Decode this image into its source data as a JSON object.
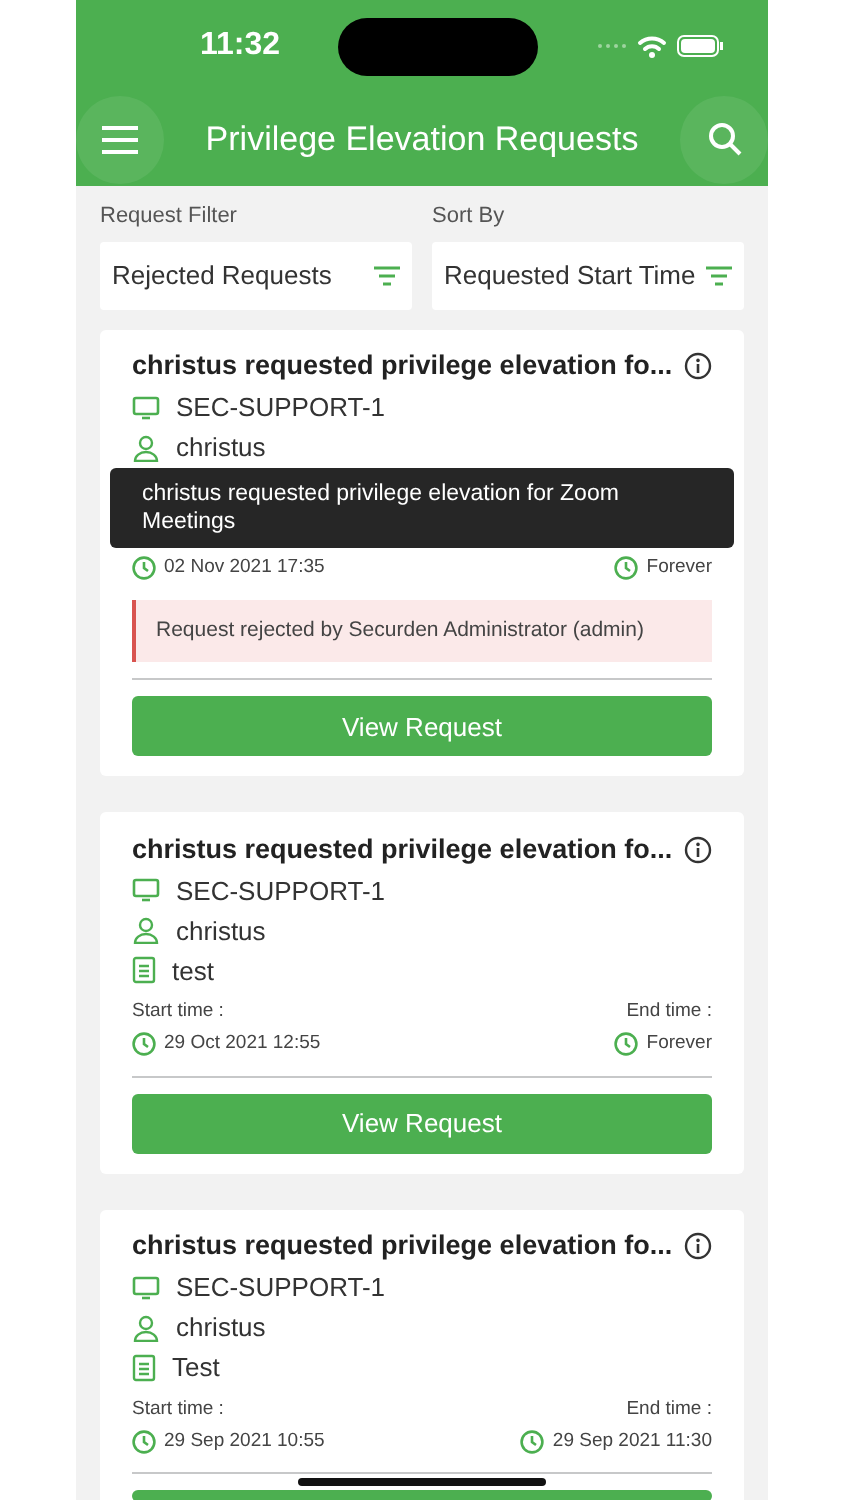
{
  "status_bar": {
    "time": "11:32"
  },
  "header": {
    "title": "Privilege Elevation Requests"
  },
  "filters": [
    {
      "label": "Request Filter",
      "value": "Rejected Requests"
    },
    {
      "label": "Sort By",
      "value": "Requested Start Time"
    }
  ],
  "requests": [
    {
      "title": "christus requested privilege elevation fo...",
      "host": "SEC-SUPPORT-1",
      "user": "christus",
      "start_time": "02 Nov 2021 17:35",
      "end_time": "Forever",
      "rejection": "Request rejected by Securden Administrator (admin)",
      "button": "View Request",
      "tooltip": "christus requested privilege elevation for Zoom Meetings"
    },
    {
      "title": "christus requested privilege elevation fo...",
      "host": "SEC-SUPPORT-1",
      "user": "christus",
      "notes": "test",
      "start_label": "Start time :",
      "start_time": "29 Oct 2021 12:55",
      "end_label": "End time :",
      "end_time": "Forever",
      "button": "View Request"
    },
    {
      "title": "christus requested privilege elevation fo...",
      "host": "SEC-SUPPORT-1",
      "user": "christus",
      "notes": "Test",
      "start_label": "Start time :",
      "start_time": "29 Sep 2021 10:55",
      "end_label": "End time :",
      "end_time": "29 Sep 2021 11:30"
    }
  ]
}
